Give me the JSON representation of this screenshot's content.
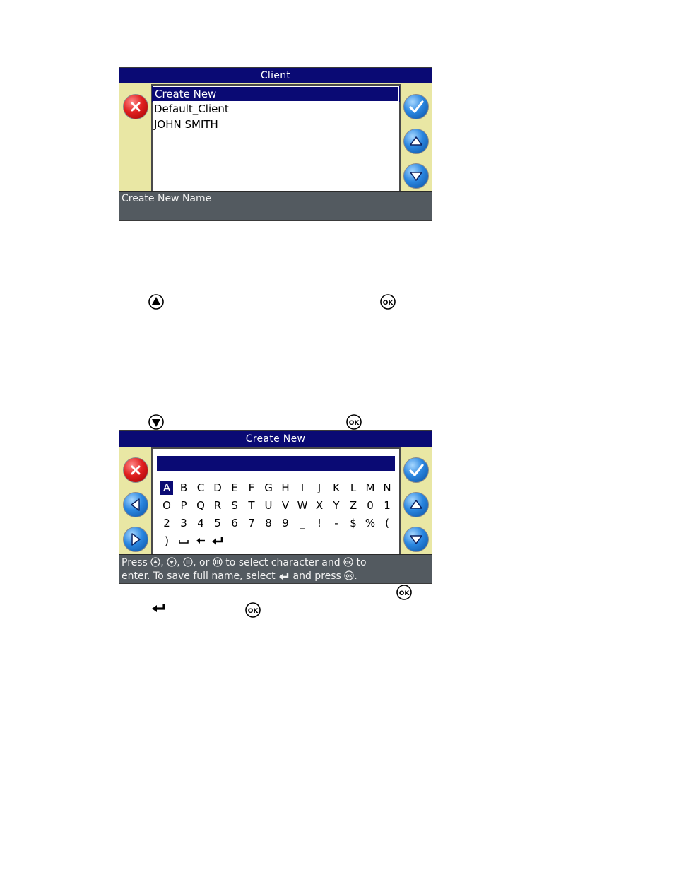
{
  "screen1": {
    "title": "Client",
    "items": [
      {
        "label": "Create New",
        "selected": true
      },
      {
        "label": "Default_Client",
        "selected": false
      },
      {
        "label": "JOHN SMITH",
        "selected": false
      }
    ],
    "status": "Create New Name"
  },
  "screen2": {
    "title": "Create New",
    "input_value": "",
    "keys": [
      [
        "A",
        "B",
        "C",
        "D",
        "E",
        "F",
        "G",
        "H",
        "I",
        "J",
        "K",
        "L",
        "M",
        "N"
      ],
      [
        "O",
        "P",
        "Q",
        "R",
        "S",
        "T",
        "U",
        "V",
        "W",
        "X",
        "Y",
        "Z",
        "0",
        "1"
      ],
      [
        "2",
        "3",
        "4",
        "5",
        "6",
        "7",
        "8",
        "9",
        "_",
        "!",
        "-",
        "$",
        "%",
        "("
      ],
      [
        ")",
        "space-icon",
        "backspace-icon",
        "enter-icon"
      ]
    ],
    "selected_key": "A",
    "status_line1": {
      "t1": "Press ",
      "t2": ", ",
      "t3": ", ",
      "t4": ", or ",
      "t5": " to select character and ",
      "t6": " to"
    },
    "status_line2": {
      "t1": "enter. To save full name, select ",
      "t2": " and press ",
      "t3": "."
    }
  },
  "icon_labels": {
    "ok": "OK",
    "status_ok": "OK"
  },
  "colors": {
    "title_bar": "#0a0a74",
    "panel": "#e9e7a4",
    "status_bar": "#535a60",
    "cancel_red": "#e02020",
    "button_blue": "#2a86e0"
  }
}
